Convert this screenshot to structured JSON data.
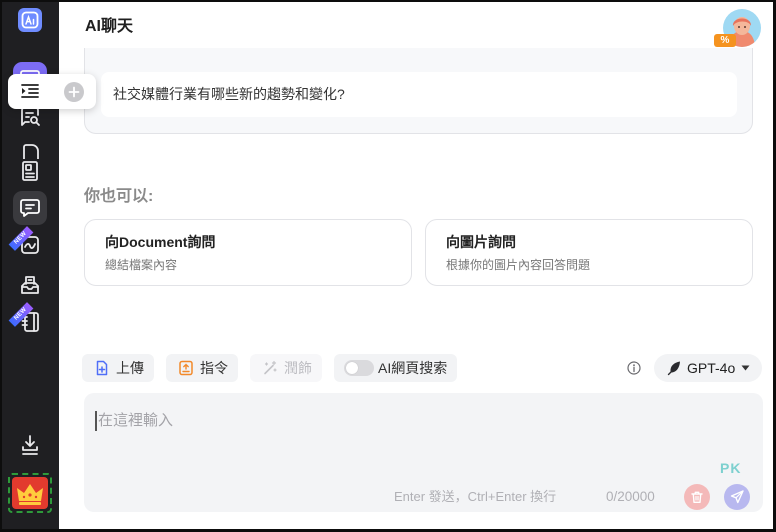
{
  "app": {
    "title": "AI聊天"
  },
  "sidebar": {
    "nav_icons": [
      "chat-bubble-icon",
      "chat-search-icon",
      "file-icon",
      "document-icon",
      "chat-icon",
      "image-icon",
      "inbox-icon",
      "notebook-icon"
    ],
    "active_item": "chat-icon",
    "new_badge": "NEW",
    "footer_icons": [
      "download-icon",
      "crown-icon"
    ]
  },
  "popover": {
    "icons": [
      "indent-menu-icon",
      "plus-circle-icon"
    ]
  },
  "avatar": {
    "badge": "%"
  },
  "conversation": {
    "question": "社交媒體行業有哪些新的趨勢和變化?"
  },
  "suggestions": {
    "heading": "你也可以:",
    "cards": [
      {
        "title": "向Document詢問",
        "subtitle": "總結檔案內容"
      },
      {
        "title": "向圖片詢問",
        "subtitle": "根據你的圖片內容回答問題"
      }
    ]
  },
  "toolbar": {
    "upload_label": "上傳",
    "command_label": "指令",
    "polish_label": "潤飾",
    "web_search_label": "AI網頁搜索",
    "web_search_enabled": false,
    "model": "GPT-4o"
  },
  "composer": {
    "placeholder": "在這裡輸入",
    "hint": "Enter 發送，Ctrl+Enter 換行",
    "char_count": "0/20000"
  },
  "watermark": {
    "text": "PK"
  },
  "colors": {
    "sidebar_bg": "#1f1f22",
    "accent_purple": "#7c6cf5",
    "upload_blue": "#4f6ef7",
    "command_orange": "#f2892a",
    "trash_red": "#f4b9b9",
    "send_purple": "#b8b8ef",
    "crown_red": "#e23a2e",
    "crown_gold": "#ffcc3d",
    "watermark": "#7dd0cf"
  }
}
